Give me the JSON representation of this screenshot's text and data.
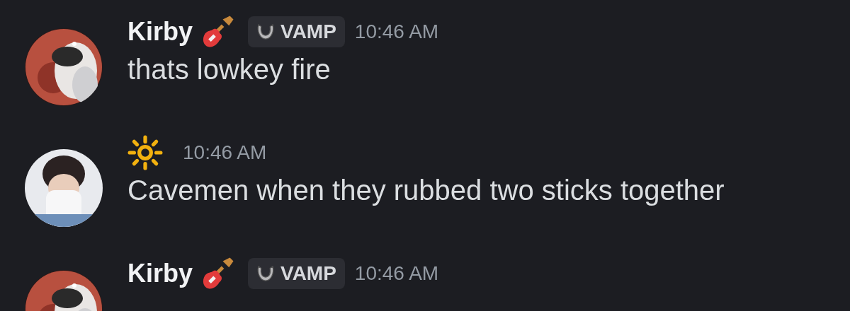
{
  "messages": [
    {
      "kind": "tagged",
      "author": "Kirby",
      "tag": "VAMP",
      "time": "10:46 AM",
      "text": "thats lowkey fire"
    },
    {
      "kind": "sun",
      "time": "10:46 AM",
      "text": "Cavemen when they rubbed two sticks together"
    },
    {
      "kind": "tagged",
      "author": "Kirby",
      "tag": "VAMP",
      "time": "10:46 AM"
    }
  ]
}
